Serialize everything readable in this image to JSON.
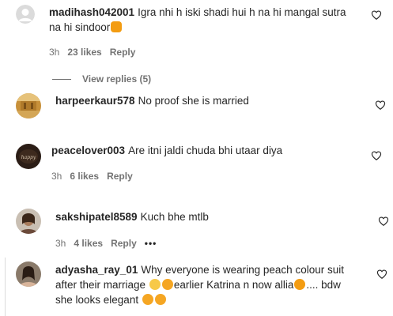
{
  "comments": [
    {
      "username": "madihash042001",
      "text_line1": "Igra nhi h iski shadi hui h na hi mangal sutra",
      "text_line2": "na hi sindoor",
      "time": "3h",
      "likes": "23 likes",
      "reply": "Reply",
      "view_replies": "View replies (5)"
    },
    {
      "username": "harpeerkaur578",
      "text_line1": "No proof she is married"
    },
    {
      "username": "peacelover003",
      "text_line1": "Are itni jaldi chuda bhi utaar diya",
      "time": "3h",
      "likes": "6 likes",
      "reply": "Reply"
    },
    {
      "username": "sakshipatel8589",
      "text_line1": "Kuch bhe mtlb",
      "time": "3h",
      "likes": "4 likes",
      "reply": "Reply",
      "more": "•••"
    },
    {
      "username": "adyasha_ray_01",
      "text_line1": "Why everyone is wearing peach colour suit",
      "text_line2a": "after their marriage",
      "text_line2b": "earlier Katrina n now allia",
      "text_line2c": ".... bdw",
      "text_line3": "she looks elegant"
    }
  ],
  "icons": {
    "like": "heart-outline-icon",
    "more": "more-options-icon"
  },
  "colors": {
    "text": "#262626",
    "secondary": "#737373",
    "emoji": "#f7b733"
  }
}
